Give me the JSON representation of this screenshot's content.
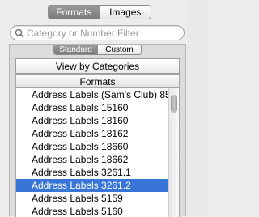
{
  "top_tabs": [
    {
      "label": "Formats",
      "active": true
    },
    {
      "label": "Images",
      "active": false
    }
  ],
  "search": {
    "placeholder": "Category or Number Filter",
    "value": ""
  },
  "sub_tabs": [
    {
      "label": "Standard",
      "active": true
    },
    {
      "label": "Custom",
      "active": false
    }
  ],
  "view_button": {
    "label": "View by Categories"
  },
  "table": {
    "header": "Formats",
    "rows": [
      {
        "label": "Address Labels (Sam's Club) 85",
        "selected": false
      },
      {
        "label": "Address Labels 15160",
        "selected": false
      },
      {
        "label": "Address Labels 18160",
        "selected": false
      },
      {
        "label": "Address Labels 18162",
        "selected": false
      },
      {
        "label": "Address Labels 18660",
        "selected": false
      },
      {
        "label": "Address Labels 18662",
        "selected": false
      },
      {
        "label": "Address Labels 3261.1",
        "selected": false
      },
      {
        "label": "Address Labels 3261.2",
        "selected": true
      },
      {
        "label": "Address Labels 5159",
        "selected": false
      },
      {
        "label": "Address Labels 5160",
        "selected": false
      }
    ]
  },
  "colors": {
    "selection": "#3875d7",
    "active_segment": "#8a8a8a"
  }
}
